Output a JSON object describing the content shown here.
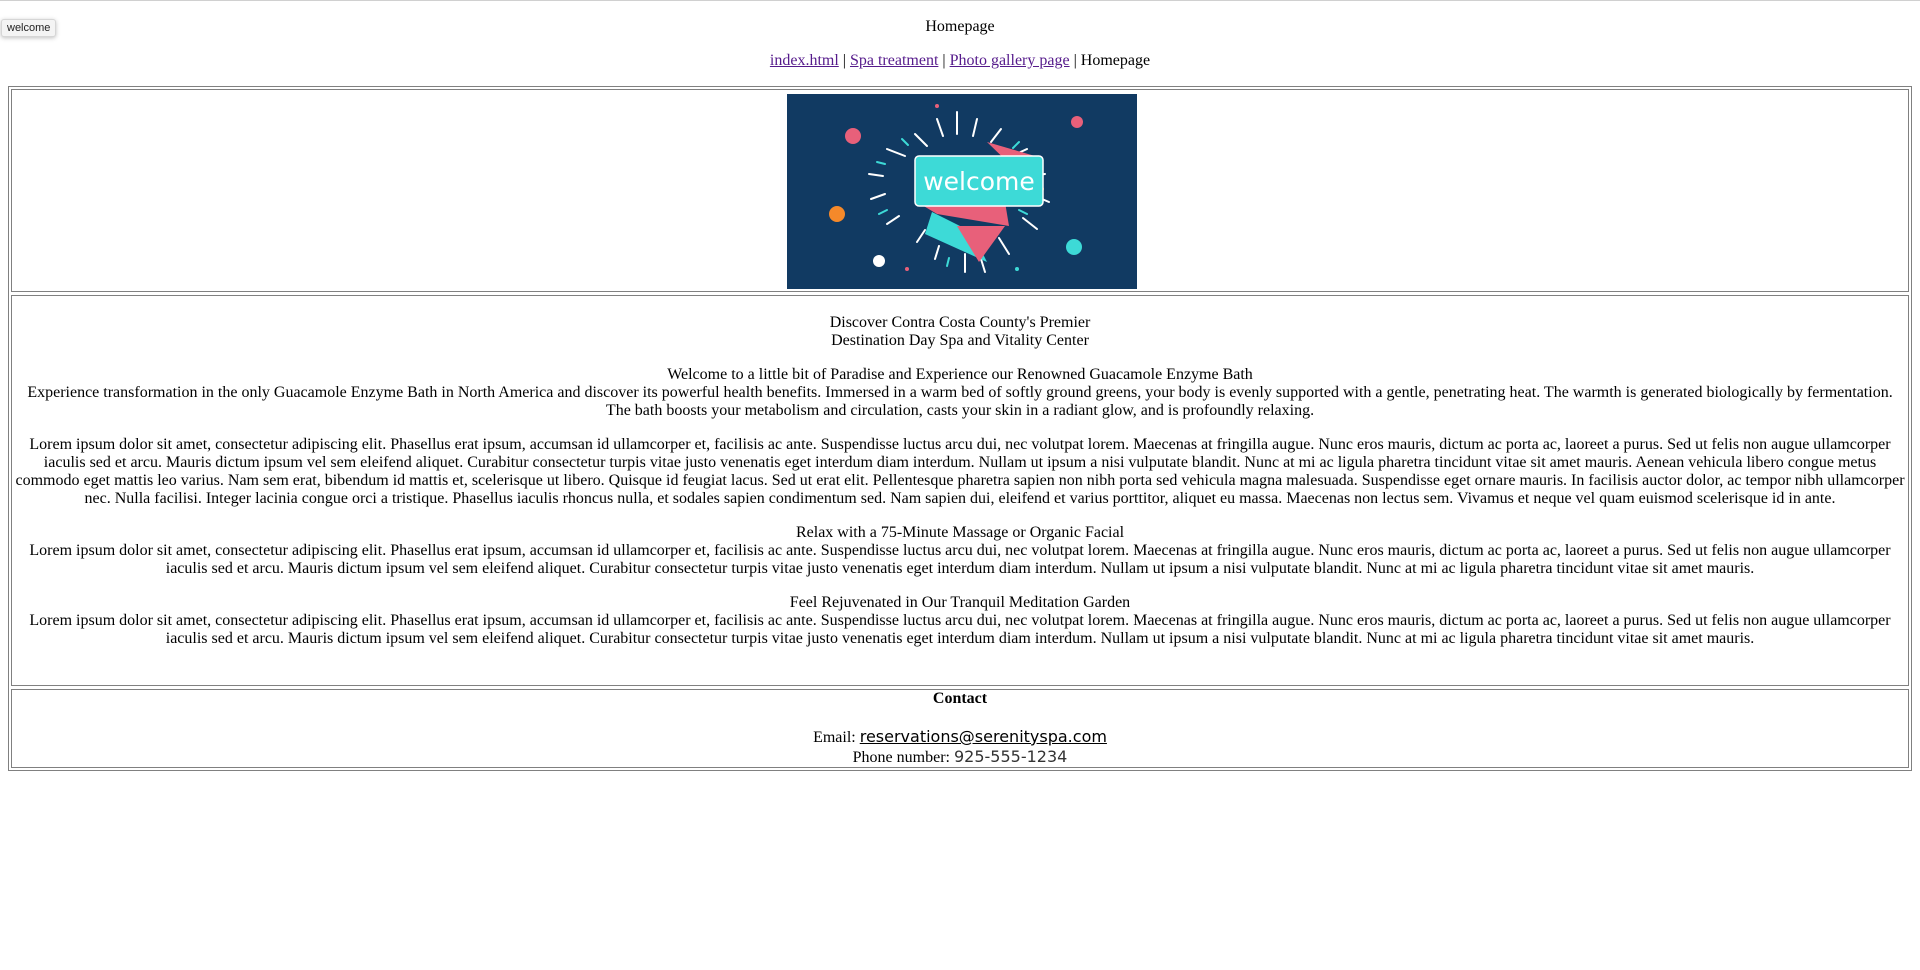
{
  "tooltip": {
    "text": "welcome"
  },
  "page": {
    "title": "Homepage"
  },
  "nav": {
    "items": [
      {
        "label": "index.html",
        "link": true
      },
      {
        "label": "Spa treatment",
        "link": true
      },
      {
        "label": "Photo gallery page",
        "link": true
      },
      {
        "label": "Homepage",
        "link": false
      }
    ],
    "separator": " | "
  },
  "banner": {
    "image_text": "welcome",
    "alt": "welcome",
    "colors": {
      "background": "#113a62",
      "sign": "#3ddad7",
      "ribbon": "#e8607a",
      "accent": "#f5892a"
    }
  },
  "content": {
    "intro_line1": "Discover Contra Costa County's Premier",
    "intro_line2": "Destination Day Spa and Vitality Center",
    "welcome_title": "Welcome to a little bit of Paradise and Experience our Renowned Guacamole Enzyme Bath",
    "welcome_text": "Experience transformation in the only Guacamole Enzyme Bath in North America and discover its powerful health benefits. Immersed in a warm bed of softly ground greens, your body is evenly supported with a gentle, penetrating heat. The warmth is generated biologically by fermentation. The bath boosts your metabolism and circulation, casts your skin in a radiant glow, and is profoundly relaxing.",
    "lorem_main": "Lorem ipsum dolor sit amet, consectetur adipiscing elit. Phasellus erat ipsum, accumsan id ullamcorper et, facilisis ac ante. Suspendisse luctus arcu dui, nec volutpat lorem. Maecenas at fringilla augue. Nunc eros mauris, dictum ac porta ac, laoreet a purus. Sed ut felis non augue ullamcorper iaculis sed et arcu. Mauris dictum ipsum vel sem eleifend aliquet. Curabitur consectetur turpis vitae justo venenatis eget interdum diam interdum. Nullam ut ipsum a nisi vulputate blandit. Nunc at mi ac ligula pharetra tincidunt vitae sit amet mauris. Aenean vehicula libero congue metus commodo eget mattis leo varius. Nam sem erat, bibendum id mattis et, scelerisque ut libero. Quisque id feugiat lacus. Sed ut erat elit. Pellentesque pharetra sapien non nibh porta sed vehicula magna malesuada. Suspendisse eget ornare mauris. In facilisis auctor dolor, ac tempor nibh ullamcorper nec. Nulla facilisi. Integer lacinia congue orci a tristique. Phasellus iaculis rhoncus nulla, et sodales sapien condimentum sed. Nam sapien dui, eleifend et varius porttitor, aliquet eu massa. Maecenas non lectus sem. Vivamus et neque vel quam euismod scelerisque id in ante.",
    "massage_title": "Relax with a 75-Minute Massage or Organic Facial",
    "massage_text": "Lorem ipsum dolor sit amet, consectetur adipiscing elit. Phasellus erat ipsum, accumsan id ullamcorper et, facilisis ac ante. Suspendisse luctus arcu dui, nec volutpat lorem. Maecenas at fringilla augue. Nunc eros mauris, dictum ac porta ac, laoreet a purus. Sed ut felis non augue ullamcorper iaculis sed et arcu. Mauris dictum ipsum vel sem eleifend aliquet. Curabitur consectetur turpis vitae justo venenatis eget interdum diam interdum. Nullam ut ipsum a nisi vulputate blandit. Nunc at mi ac ligula pharetra tincidunt vitae sit amet mauris.",
    "garden_title": "Feel Rejuvenated in Our Tranquil Meditation Garden",
    "garden_text": "Lorem ipsum dolor sit amet, consectetur adipiscing elit. Phasellus erat ipsum, accumsan id ullamcorper et, facilisis ac ante. Suspendisse luctus arcu dui, nec volutpat lorem. Maecenas at fringilla augue. Nunc eros mauris, dictum ac porta ac, laoreet a purus. Sed ut felis non augue ullamcorper iaculis sed et arcu. Mauris dictum ipsum vel sem eleifend aliquet. Curabitur consectetur turpis vitae justo venenatis eget interdum diam interdum. Nullam ut ipsum a nisi vulputate blandit. Nunc at mi ac ligula pharetra tincidunt vitae sit amet mauris."
  },
  "contact": {
    "heading": "Contact",
    "email_label": "Email: ",
    "email_value": "reservations@serenityspa.com",
    "phone_label": "Phone number: ",
    "phone_value": "925-555-1234"
  }
}
